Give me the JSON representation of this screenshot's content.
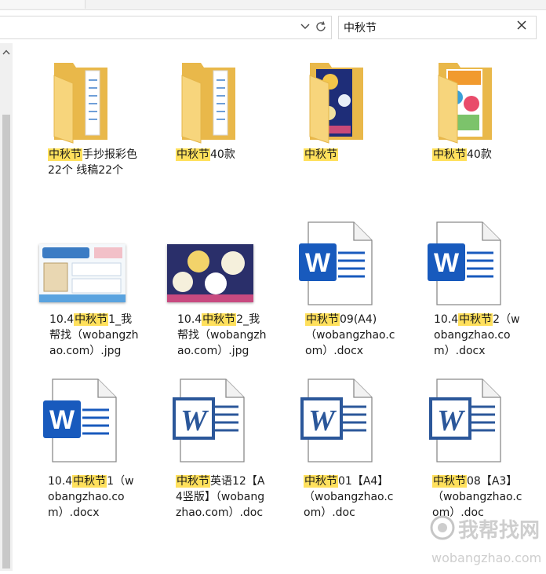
{
  "search": {
    "value": "中秋节"
  },
  "highlight": "中秋节",
  "items": [
    {
      "type": "folder",
      "variant": "plain",
      "pre": "",
      "post": "手抄报彩色22个 线稿22个"
    },
    {
      "type": "folder",
      "variant": "plain",
      "pre": "",
      "post": "40款"
    },
    {
      "type": "folder",
      "variant": "blue-poster",
      "pre": "",
      "post": ""
    },
    {
      "type": "folder",
      "variant": "colorful-poster",
      "pre": "",
      "post": "40款"
    },
    {
      "type": "image",
      "variant": "light",
      "pre": "10.4",
      "post": "1_我帮找（wobangzhao.com）.jpg"
    },
    {
      "type": "image",
      "variant": "dark",
      "pre": "10.4",
      "post": "2_我帮找（wobangzhao.com）.jpg"
    },
    {
      "type": "docx",
      "variant": "word-new",
      "pre": "",
      "post": "09(A4)（wobangzhao.com）.docx"
    },
    {
      "type": "docx",
      "variant": "word-new",
      "pre": "10.4",
      "post": "2（wobangzhao.com）.docx"
    },
    {
      "type": "docx",
      "variant": "word-new",
      "pre": "10.4",
      "post": "1（wobangzhao.com）.docx"
    },
    {
      "type": "doc",
      "variant": "word-old",
      "pre": "",
      "post": "英语12【A4竖版】（wobangzhao.com）.doc"
    },
    {
      "type": "doc",
      "variant": "word-old",
      "pre": "",
      "post": "01【A4】（wobangzhao.com）.doc"
    },
    {
      "type": "doc",
      "variant": "word-old",
      "pre": "",
      "post": "08【A3】（wobangzhao.com）.doc"
    }
  ],
  "watermark": {
    "text": "我帮找网",
    "url": "wobangzhao.com"
  },
  "colors": {
    "highlight": "#ffe05c",
    "folder": "#f4d27a",
    "word_blue": "#185abd",
    "word_old_blue": "#2b579a"
  }
}
